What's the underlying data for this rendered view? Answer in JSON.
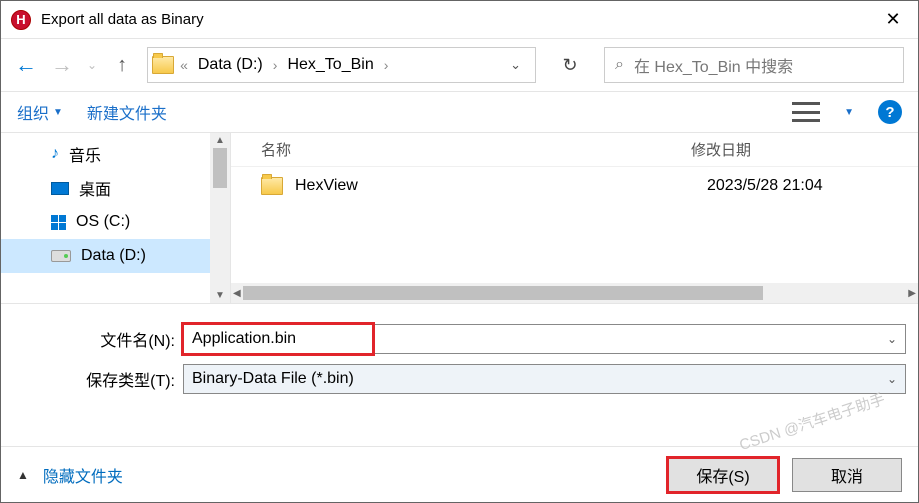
{
  "window": {
    "title": "Export all data as Binary",
    "app_initial": "H"
  },
  "breadcrumbs": {
    "sep1": "«",
    "drive": "Data (D:)",
    "folder": "Hex_To_Bin"
  },
  "search": {
    "placeholder": "在 Hex_To_Bin 中搜索"
  },
  "toolbar": {
    "organize": "组织",
    "new_folder": "新建文件夹"
  },
  "sidebar": {
    "items": [
      {
        "label": "音乐"
      },
      {
        "label": "桌面"
      },
      {
        "label": "OS (C:)"
      },
      {
        "label": "Data (D:)"
      }
    ]
  },
  "columns": {
    "name": "名称",
    "date": "修改日期"
  },
  "files": [
    {
      "name": "HexView",
      "date": "2023/5/28 21:04"
    }
  ],
  "form": {
    "filename_label": "文件名(N):",
    "filename_value": "Application.bin",
    "filetype_label": "保存类型(T):",
    "filetype_value": "Binary-Data File (*.bin)"
  },
  "footer": {
    "hide_folders": "隐藏文件夹",
    "save": "保存(S)",
    "cancel": "取消"
  },
  "watermark": "CSDN @汽车电子助手"
}
